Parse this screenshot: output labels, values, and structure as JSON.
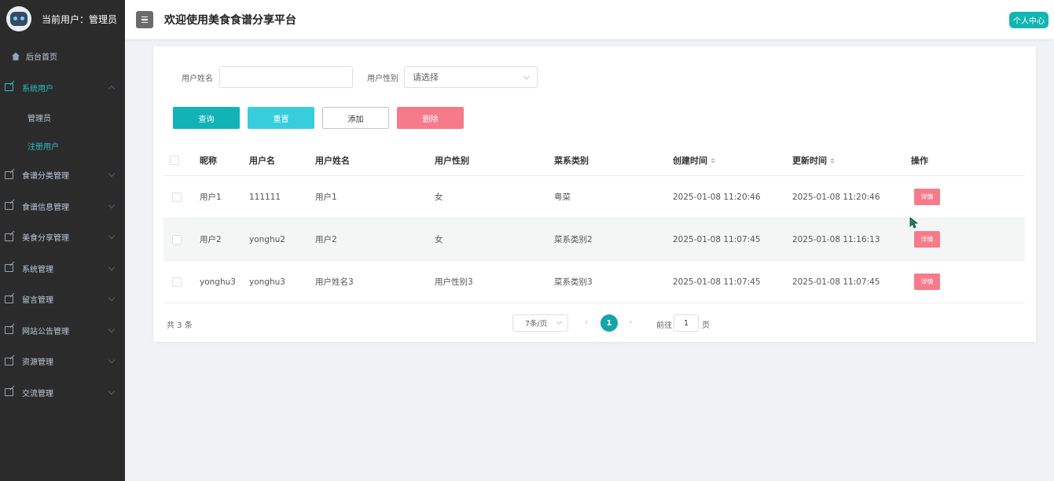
{
  "sidebar": {
    "user_label": "当前用户：管理员",
    "home": "后台首页",
    "items": [
      {
        "label": "系统用户",
        "expanded": true
      },
      {
        "label": "食谱分类管理"
      },
      {
        "label": "食谱信息管理"
      },
      {
        "label": "美食分享管理"
      },
      {
        "label": "系统管理"
      },
      {
        "label": "留言管理"
      },
      {
        "label": "网站公告管理"
      },
      {
        "label": "资源管理"
      },
      {
        "label": "交流管理"
      }
    ],
    "subitems": [
      {
        "label": "管理员"
      },
      {
        "label": "注册用户",
        "active": true
      }
    ]
  },
  "header": {
    "title": "欢迎使用美食食谱分享平台",
    "profile_button": "个人中心"
  },
  "filters": {
    "name_label": "用户姓名",
    "name_value": "",
    "gender_label": "用户性别",
    "gender_placeholder": "请选择"
  },
  "buttons": {
    "query": "查询",
    "reset": "重置",
    "add": "添加",
    "delete": "删除"
  },
  "table": {
    "headers": [
      "昵称",
      "用户名",
      "用户姓名",
      "用户性别",
      "菜系类别",
      "创建时间",
      "更新时间",
      "操作"
    ],
    "rows": [
      {
        "nickname": "用户1",
        "username": "111111",
        "realname": "用户1",
        "gender": "女",
        "cuisine": "粤菜",
        "created": "2025-01-08 11:20:46",
        "updated": "2025-01-08 11:20:46",
        "action": "详情"
      },
      {
        "nickname": "用户2",
        "username": "yonghu2",
        "realname": "用户2",
        "gender": "女",
        "cuisine": "菜系类别2",
        "created": "2025-01-08 11:07:45",
        "updated": "2025-01-08 11:16:13",
        "action": "详情"
      },
      {
        "nickname": "yonghu3",
        "username": "yonghu3",
        "realname": "用户姓名3",
        "gender": "用户性别3",
        "cuisine": "菜系类别3",
        "created": "2025-01-08 11:07:45",
        "updated": "2025-01-08 11:07:45",
        "action": "详情"
      }
    ]
  },
  "pagination": {
    "total": "共 3 条",
    "page_size": "7条/页",
    "prev": "‹",
    "next": "›",
    "current_page": "1",
    "goto_label": "前往",
    "goto_value": "1",
    "page_unit": "页"
  },
  "colors": {
    "sidebar_bg": "#2b2b2b",
    "accent": "#13b5b1",
    "danger": "#f67b8a",
    "reset": "#38cddc"
  }
}
